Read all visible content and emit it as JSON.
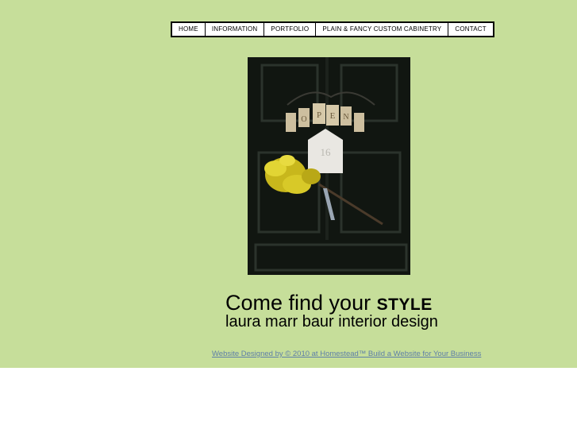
{
  "nav": {
    "items": [
      {
        "label": "HOME"
      },
      {
        "label": "INFORMATION"
      },
      {
        "label": "PORTFOLIO"
      },
      {
        "label": "PLAIN & FANCY CUSTOM CABINETRY"
      },
      {
        "label": "CONTACT"
      }
    ]
  },
  "hero": {
    "image_subject": "dark green front door with OPEN sign tags and yellow forsythia bouquet",
    "sign_letters": [
      "O",
      "P",
      "E",
      "N"
    ],
    "house_number": "16"
  },
  "tagline": {
    "prefix": "Come find your ",
    "emphasis": "STYLE",
    "subtitle": "laura marr baur interior design"
  },
  "footer": {
    "link_text": "Website Designed by © 2010 at Homestead™ Build a Website for Your Business"
  },
  "colors": {
    "background_green": "#c6de9a",
    "door": "#0f1410",
    "link": "#5e7fa8"
  }
}
